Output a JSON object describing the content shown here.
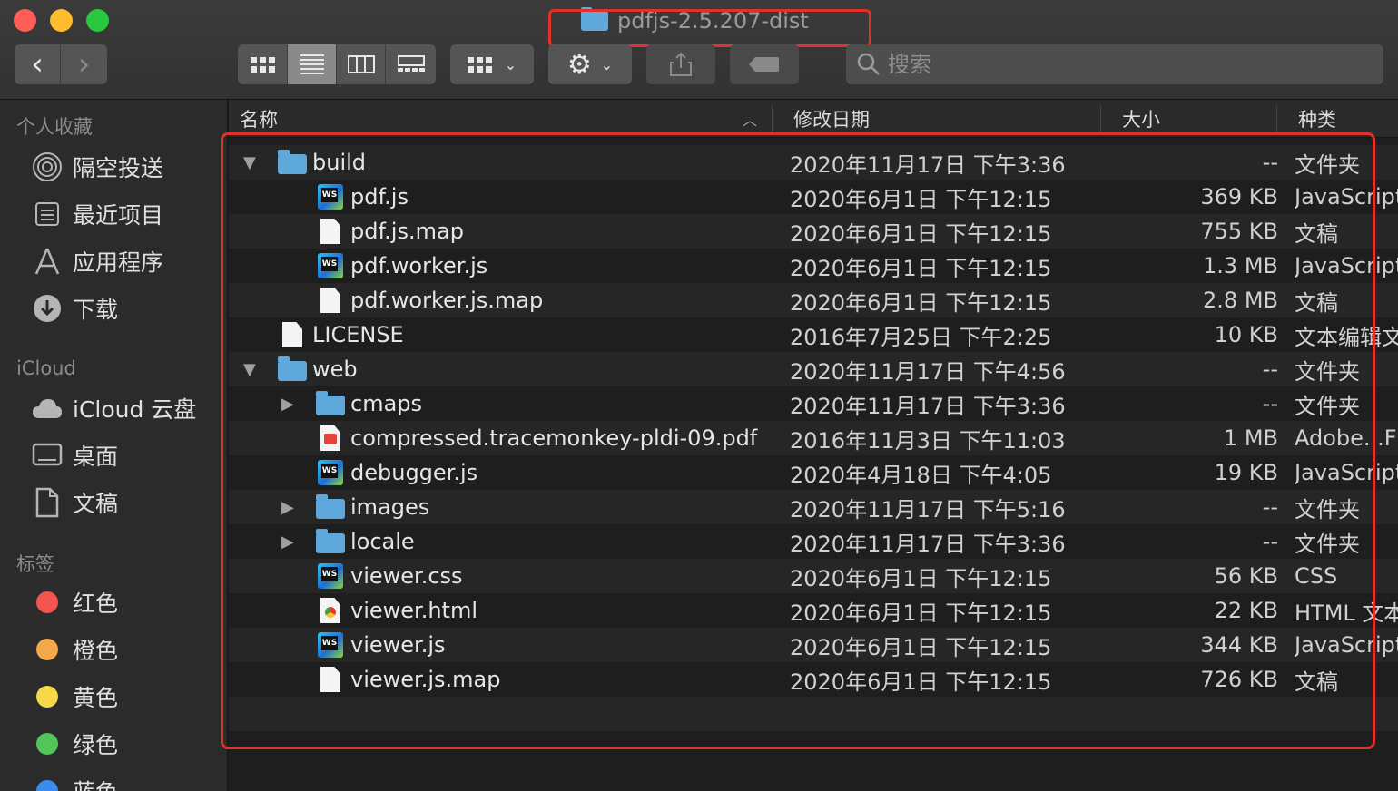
{
  "window": {
    "title": "pdfjs-2.5.207-dist"
  },
  "toolbar": {
    "back_glyph": "‹",
    "forward_glyph": "›",
    "search_placeholder": "搜索"
  },
  "sidebar": {
    "favorites_label": "个人收藏",
    "favorites": [
      {
        "label": "隔空投送",
        "icon": "airdrop-icon"
      },
      {
        "label": "最近项目",
        "icon": "recents-icon"
      },
      {
        "label": "应用程序",
        "icon": "applications-icon"
      },
      {
        "label": "下载",
        "icon": "downloads-icon"
      }
    ],
    "icloud_label": "iCloud",
    "icloud": [
      {
        "label": "iCloud 云盘",
        "icon": "cloud-icon"
      },
      {
        "label": "桌面",
        "icon": "desktop-icon"
      },
      {
        "label": "文稿",
        "icon": "documents-icon"
      }
    ],
    "tags_label": "标签",
    "tags": [
      {
        "label": "红色",
        "color": "#f4544e"
      },
      {
        "label": "橙色",
        "color": "#f5a84a"
      },
      {
        "label": "黄色",
        "color": "#f7d84b"
      },
      {
        "label": "绿色",
        "color": "#53c45a"
      },
      {
        "label": "蓝色",
        "color": "#3b8cf0"
      }
    ]
  },
  "columns": {
    "name": "名称",
    "date": "修改日期",
    "size": "大小",
    "kind": "种类"
  },
  "files": [
    {
      "name": "build",
      "date": "2020年11月17日 下午3:36",
      "size": "--",
      "kind": "文件夹",
      "type": "folder",
      "depth": 0,
      "disclosure": "▼"
    },
    {
      "name": "pdf.js",
      "date": "2020年6月1日 下午12:15",
      "size": "369 KB",
      "kind": "JavaScript",
      "type": "ws",
      "depth": 1,
      "disclosure": ""
    },
    {
      "name": "pdf.js.map",
      "date": "2020年6月1日 下午12:15",
      "size": "755 KB",
      "kind": "文稿",
      "type": "doc",
      "depth": 1,
      "disclosure": ""
    },
    {
      "name": "pdf.worker.js",
      "date": "2020年6月1日 下午12:15",
      "size": "1.3 MB",
      "kind": "JavaScript",
      "type": "ws",
      "depth": 1,
      "disclosure": ""
    },
    {
      "name": "pdf.worker.js.map",
      "date": "2020年6月1日 下午12:15",
      "size": "2.8 MB",
      "kind": "文稿",
      "type": "doc",
      "depth": 1,
      "disclosure": ""
    },
    {
      "name": "LICENSE",
      "date": "2016年7月25日 下午2:25",
      "size": "10 KB",
      "kind": "文本编辑文稿",
      "type": "doc",
      "depth": 0,
      "disclosure": ""
    },
    {
      "name": "web",
      "date": "2020年11月17日 下午4:56",
      "size": "--",
      "kind": "文件夹",
      "type": "folder",
      "depth": 0,
      "disclosure": "▼"
    },
    {
      "name": "cmaps",
      "date": "2020年11月17日 下午3:36",
      "size": "--",
      "kind": "文件夹",
      "type": "folder",
      "depth": 1,
      "disclosure": "▶"
    },
    {
      "name": "compressed.tracemonkey-pldi-09.pdf",
      "date": "2016年11月3日 下午11:03",
      "size": "1 MB",
      "kind": "Adobe...F",
      "type": "pdf",
      "depth": 1,
      "disclosure": ""
    },
    {
      "name": "debugger.js",
      "date": "2020年4月18日 下午4:05",
      "size": "19 KB",
      "kind": "JavaScript",
      "type": "ws",
      "depth": 1,
      "disclosure": ""
    },
    {
      "name": "images",
      "date": "2020年11月17日 下午5:16",
      "size": "--",
      "kind": "文件夹",
      "type": "folder",
      "depth": 1,
      "disclosure": "▶"
    },
    {
      "name": "locale",
      "date": "2020年11月17日 下午3:36",
      "size": "--",
      "kind": "文件夹",
      "type": "folder",
      "depth": 1,
      "disclosure": "▶"
    },
    {
      "name": "viewer.css",
      "date": "2020年6月1日 下午12:15",
      "size": "56 KB",
      "kind": "CSS",
      "type": "ws",
      "depth": 1,
      "disclosure": ""
    },
    {
      "name": "viewer.html",
      "date": "2020年6月1日 下午12:15",
      "size": "22 KB",
      "kind": "HTML 文本",
      "type": "html",
      "depth": 1,
      "disclosure": ""
    },
    {
      "name": "viewer.js",
      "date": "2020年6月1日 下午12:15",
      "size": "344 KB",
      "kind": "JavaScript",
      "type": "ws",
      "depth": 1,
      "disclosure": ""
    },
    {
      "name": "viewer.js.map",
      "date": "2020年6月1日 下午12:15",
      "size": "726 KB",
      "kind": "文稿",
      "type": "doc",
      "depth": 1,
      "disclosure": ""
    }
  ],
  "colors": {
    "annotation": "#e0312a",
    "folder": "#5fa8dc"
  }
}
